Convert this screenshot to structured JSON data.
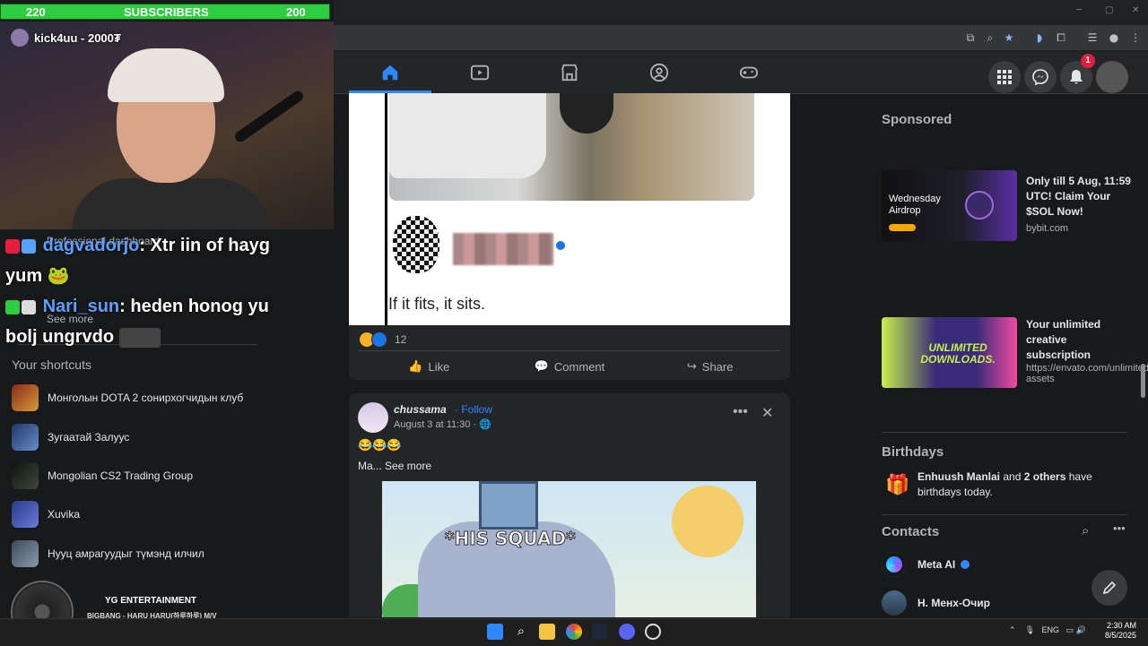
{
  "overlay": {
    "sub_left": "220",
    "sub_label": "SUBSCRIBERS",
    "sub_right": "200",
    "cam_tag": "kick4uu - 2000₮",
    "chat": [
      {
        "name": "dagvadorjo",
        "msg": ": Xtr iin of hayg",
        "cont": "yum"
      },
      {
        "name": "Nari_sun",
        "msg": ":  heden honog yu",
        "cont": "bolj ungrvdo"
      }
    ],
    "faint_top": "Professional dashboard",
    "faint_see_more": "See more",
    "shortcuts_heading": "Your shortcuts",
    "shortcuts": [
      {
        "label": "Монголын DOTA 2 сонирхогчидын клуб"
      },
      {
        "label": "Зугаатай Залуус"
      },
      {
        "label": "Mongolian CS2 Trading Group"
      },
      {
        "label": "Xuvika"
      },
      {
        "label": "Нууц амрагуудыг түмэнд илчил"
      }
    ],
    "music_title": "YG ENTERTAINMENT",
    "music_sub": "BIGBANG - HARU HARU(하루하루) M/V"
  },
  "nav": {
    "notification_count": "1",
    "tabs": [
      "home-icon",
      "video-icon",
      "marketplace-icon",
      "groups-icon",
      "gaming-icon"
    ]
  },
  "post1": {
    "caption": "If it fits, it sits.",
    "reaction_count": "12",
    "like": "Like",
    "comment": "Comment",
    "share": "Share"
  },
  "post2": {
    "author": "chussama",
    "follow": "· Follow",
    "date": "August 3 at 11:30 ·",
    "emojis": "😂😂😂",
    "text_prefix": "Ma... ",
    "see_more": "See more",
    "meme_text": "*HIS SQUAD*"
  },
  "right": {
    "sponsored": "Sponsored",
    "ads": [
      {
        "title": "Only till 5 Aug, 11:59 UTC! Claim Your $SOL Now!",
        "url": "bybit.com",
        "img_text": "Wednesday Airdrop"
      },
      {
        "title": "Your unlimited creative subscription",
        "url": "https://envato.com/unlimited-assets",
        "img_text": "UNLIMITED DOWNLOADS."
      }
    ],
    "birthdays_heading": "Birthdays",
    "birthday_name": "Enhuush Manlai",
    "birthday_mid": " and ",
    "birthday_others": "2 others",
    "birthday_tail": " have birthdays today.",
    "contacts_heading": "Contacts",
    "contacts": [
      "Meta AI",
      "Н. Менх-Очир"
    ]
  },
  "taskbar": {
    "lang": "ENG",
    "time": "2:30 AM",
    "date": "8/5/2025"
  },
  "colors": {
    "accent": "#2d88ff",
    "bg": "#18191a",
    "card": "#242526",
    "sub_bar": "#2ecc40"
  }
}
